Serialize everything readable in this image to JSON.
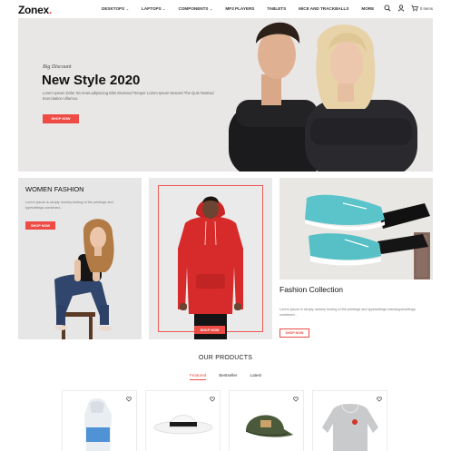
{
  "header": {
    "logo": "Zonex",
    "logo_dot": ".",
    "nav": [
      {
        "label": "DESKTOPS",
        "caret": "⌄"
      },
      {
        "label": "LAPTOPS",
        "caret": "⌄"
      },
      {
        "label": "COMPONENTS",
        "caret": "⌄"
      },
      {
        "label": "MP3 PLAYERS",
        "caret": ""
      },
      {
        "label": "TABLETS",
        "caret": ""
      },
      {
        "label": "MICE AND TRACKBALLS",
        "caret": ""
      },
      {
        "label": "MORE",
        "caret": ""
      }
    ],
    "cart_text": "0 items"
  },
  "hero": {
    "subtitle": "Big Discount",
    "title": "New Style 2020",
    "description": "Lorem Ipsum Dolor Sit Amet,adipiscing Elits Eiusmod Tempor Lorem Ipsum Nesctet The Quis Nostrud Exercitation Ullamco.",
    "button": "SHOP NOW"
  },
  "banner_women": {
    "title": "WOMEN FASHION",
    "description": "Lorem ipsum is simply dummy texting of the printings and typesettings combined...",
    "button": "SHOP NOW"
  },
  "banner_hoodie": {
    "button": "SHOP NOW"
  },
  "banner_collection": {
    "title": "Fashion Collection",
    "description": "Lorem ipsum is simply dummy texting of the printings and typesettings industrypesettings combined...",
    "button": "SHOP NOW"
  },
  "products": {
    "title": "OUR PRODUCTS",
    "tabs": [
      "Featured",
      "Bestseller",
      "Latest"
    ]
  },
  "colors": {
    "accent": "#ee4b45",
    "hero_bg": "#e9e6e6"
  }
}
